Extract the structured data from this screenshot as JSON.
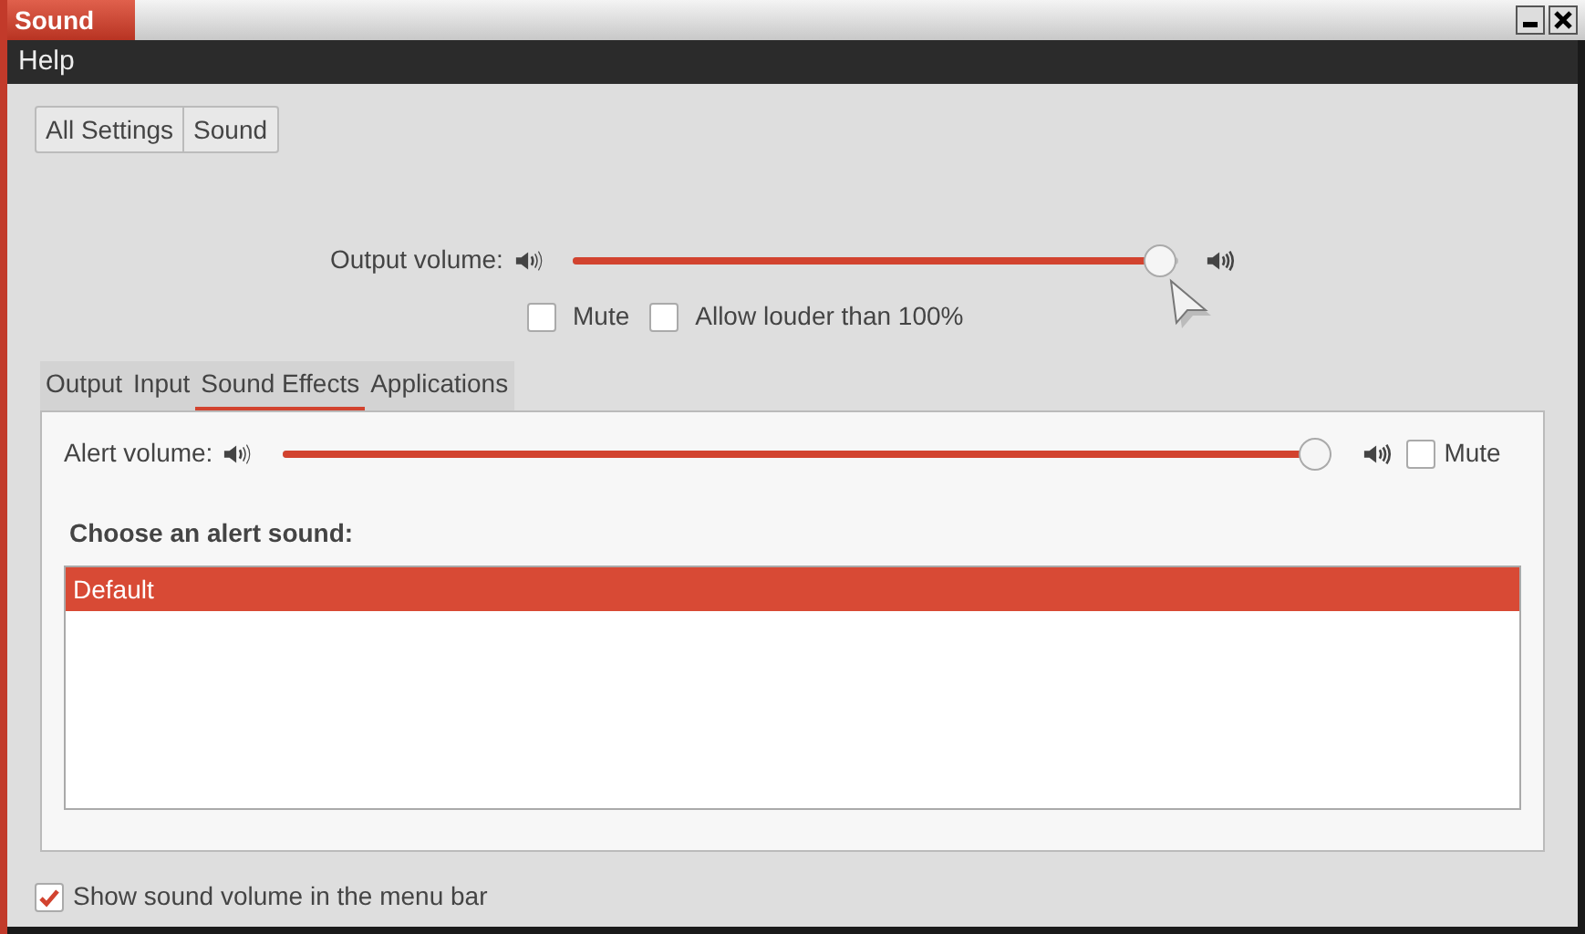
{
  "window": {
    "title": "Sound"
  },
  "menu": [
    "Help"
  ],
  "breadcrumbs": [
    {
      "label": "All Settings"
    },
    {
      "label": "Sound"
    }
  ],
  "output_volume": {
    "label": "Output volume:",
    "level": 0.97
  },
  "output_options": [
    {
      "label": "Mute",
      "checked": false
    },
    {
      "label": "Allow louder than 100%",
      "checked": false
    }
  ],
  "tabs": [
    {
      "label": "Output",
      "selected": false
    },
    {
      "label": "Input",
      "selected": false
    },
    {
      "label": "Sound Effects",
      "selected": true
    },
    {
      "label": "Applications",
      "selected": false
    }
  ],
  "alert_volume": {
    "label": "Alert volume:",
    "level": 0.985,
    "mute": {
      "label": "Mute",
      "checked": false
    }
  },
  "alert_sounds": {
    "heading": "Choose an alert sound:",
    "items": [
      {
        "label": "Default",
        "selected": true
      }
    ]
  },
  "show_in_menu_bar": {
    "label": "Show sound volume in the menu bar",
    "checked": true
  }
}
